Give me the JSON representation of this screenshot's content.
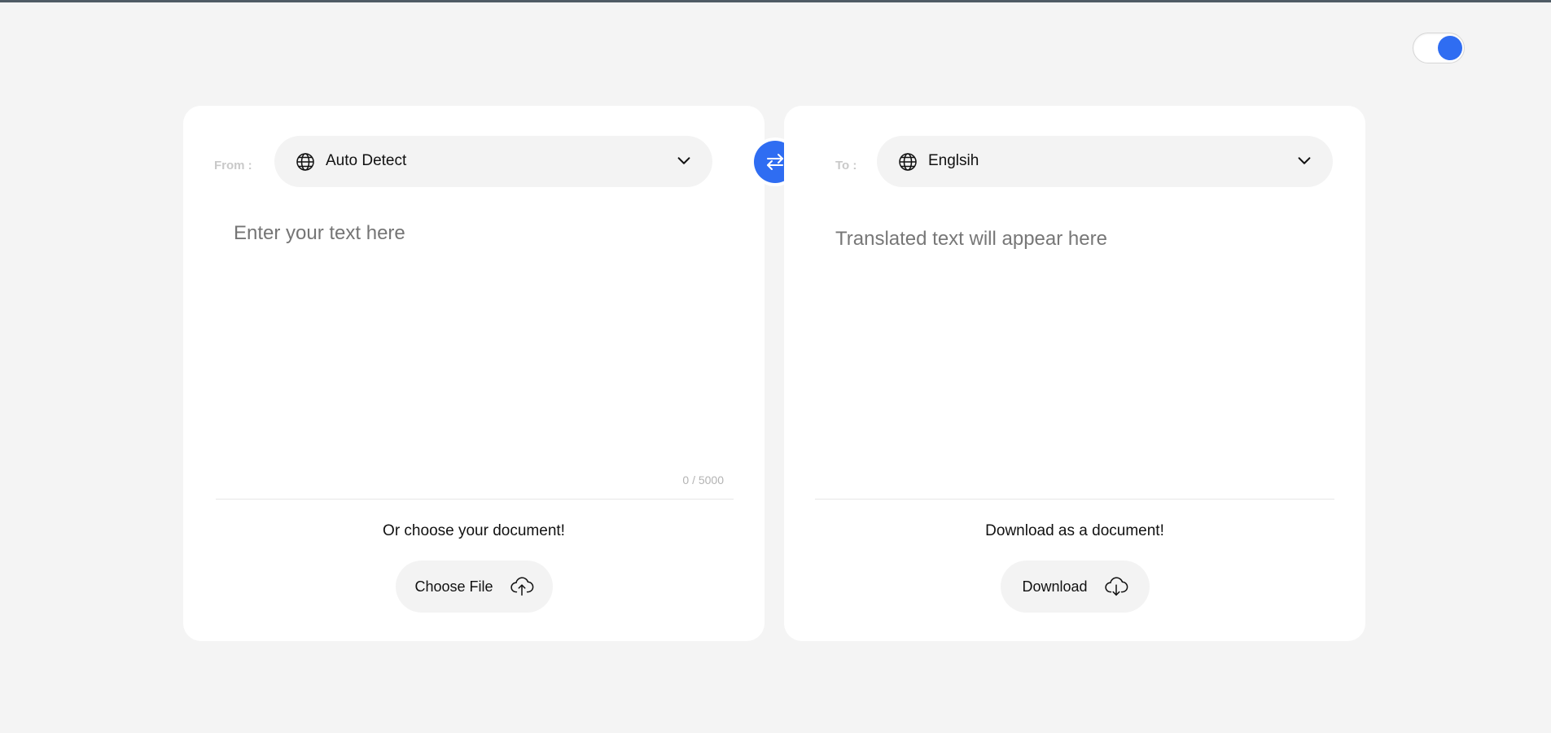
{
  "theme": {
    "accent": "#2f6df2",
    "background": "#f4f4f4",
    "card": "#ffffff"
  },
  "theme_toggle": {
    "icon": "toggle-switch",
    "on": true
  },
  "source": {
    "label": "From :",
    "language": "Auto Detect",
    "language_icon": "globe-icon",
    "placeholder": "Enter your text here",
    "value": "",
    "char_count": "0 / 5000",
    "doc_caption": "Or choose your document!",
    "doc_button": "Choose File",
    "doc_button_icon": "cloud-upload-icon"
  },
  "swap": {
    "icon": "swap-arrows-icon"
  },
  "target": {
    "label": "To :",
    "language": "Englsih",
    "language_icon": "globe-icon",
    "placeholder": "Translated text will appear here",
    "doc_caption": "Download as a document!",
    "doc_button": "Download",
    "doc_button_icon": "cloud-download-icon"
  }
}
